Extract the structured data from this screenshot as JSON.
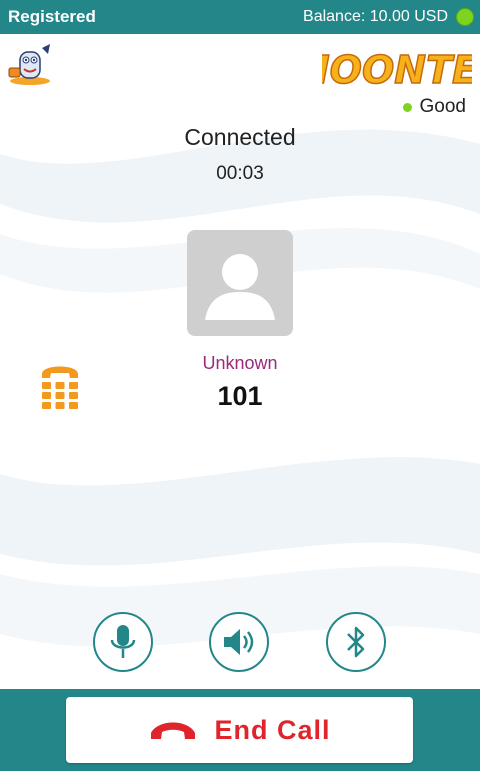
{
  "status_bar": {
    "registration": "Registered",
    "balance": "Balance: 10.00 USD",
    "online_color": "#7ed321"
  },
  "header": {
    "logo_text": "MOONTEL",
    "mascot_icon": "mascot-icon",
    "quality_label": "Good",
    "quality_color": "#7ed321"
  },
  "call": {
    "status": "Connected",
    "timer": "00:03",
    "caller_name": "Unknown",
    "caller_number": "101",
    "avatar_icon": "person-icon"
  },
  "controls": {
    "mic_icon": "microphone-icon",
    "speaker_icon": "speaker-icon",
    "bluetooth_icon": "bluetooth-icon",
    "dialpad_icon": "dialpad-icon"
  },
  "end_call": {
    "label": "End Call",
    "icon": "hangup-icon",
    "color": "#e0242b"
  },
  "theme": {
    "primary": "#23878a",
    "caller_name_color": "#9b2a7a",
    "dialpad_color": "#f39a1e"
  }
}
